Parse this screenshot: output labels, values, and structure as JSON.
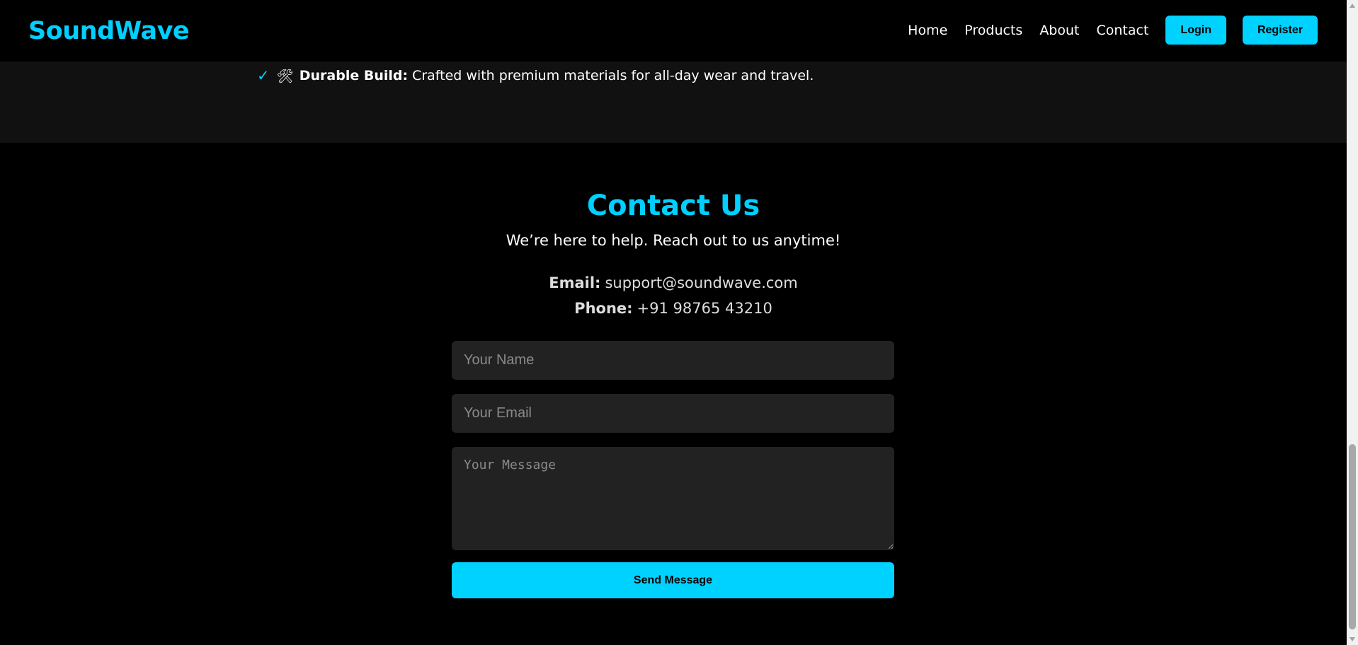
{
  "header": {
    "brand": "SoundWave",
    "nav": [
      "Home",
      "Products",
      "About",
      "Contact"
    ],
    "login_label": "Login",
    "register_label": "Register"
  },
  "features": {
    "item": {
      "check_icon": "✓",
      "tools_icon": "🛠",
      "title": "Durable Build:",
      "text": "Crafted with premium materials for all-day wear and travel."
    }
  },
  "contact": {
    "title": "Contact Us",
    "subtitle": "We’re here to help. Reach out to us anytime!",
    "email_label": "Email:",
    "email_value": "support@soundwave.com",
    "phone_label": "Phone:",
    "phone_value": "+91 98765 43210",
    "form": {
      "name_placeholder": "Your Name",
      "email_placeholder": "Your Email",
      "message_placeholder": "Your Message",
      "submit_label": "Send Message"
    }
  },
  "colors": {
    "accent": "#00d2ff",
    "background": "#000000",
    "features_bg": "#111111",
    "field_bg": "#222222"
  }
}
